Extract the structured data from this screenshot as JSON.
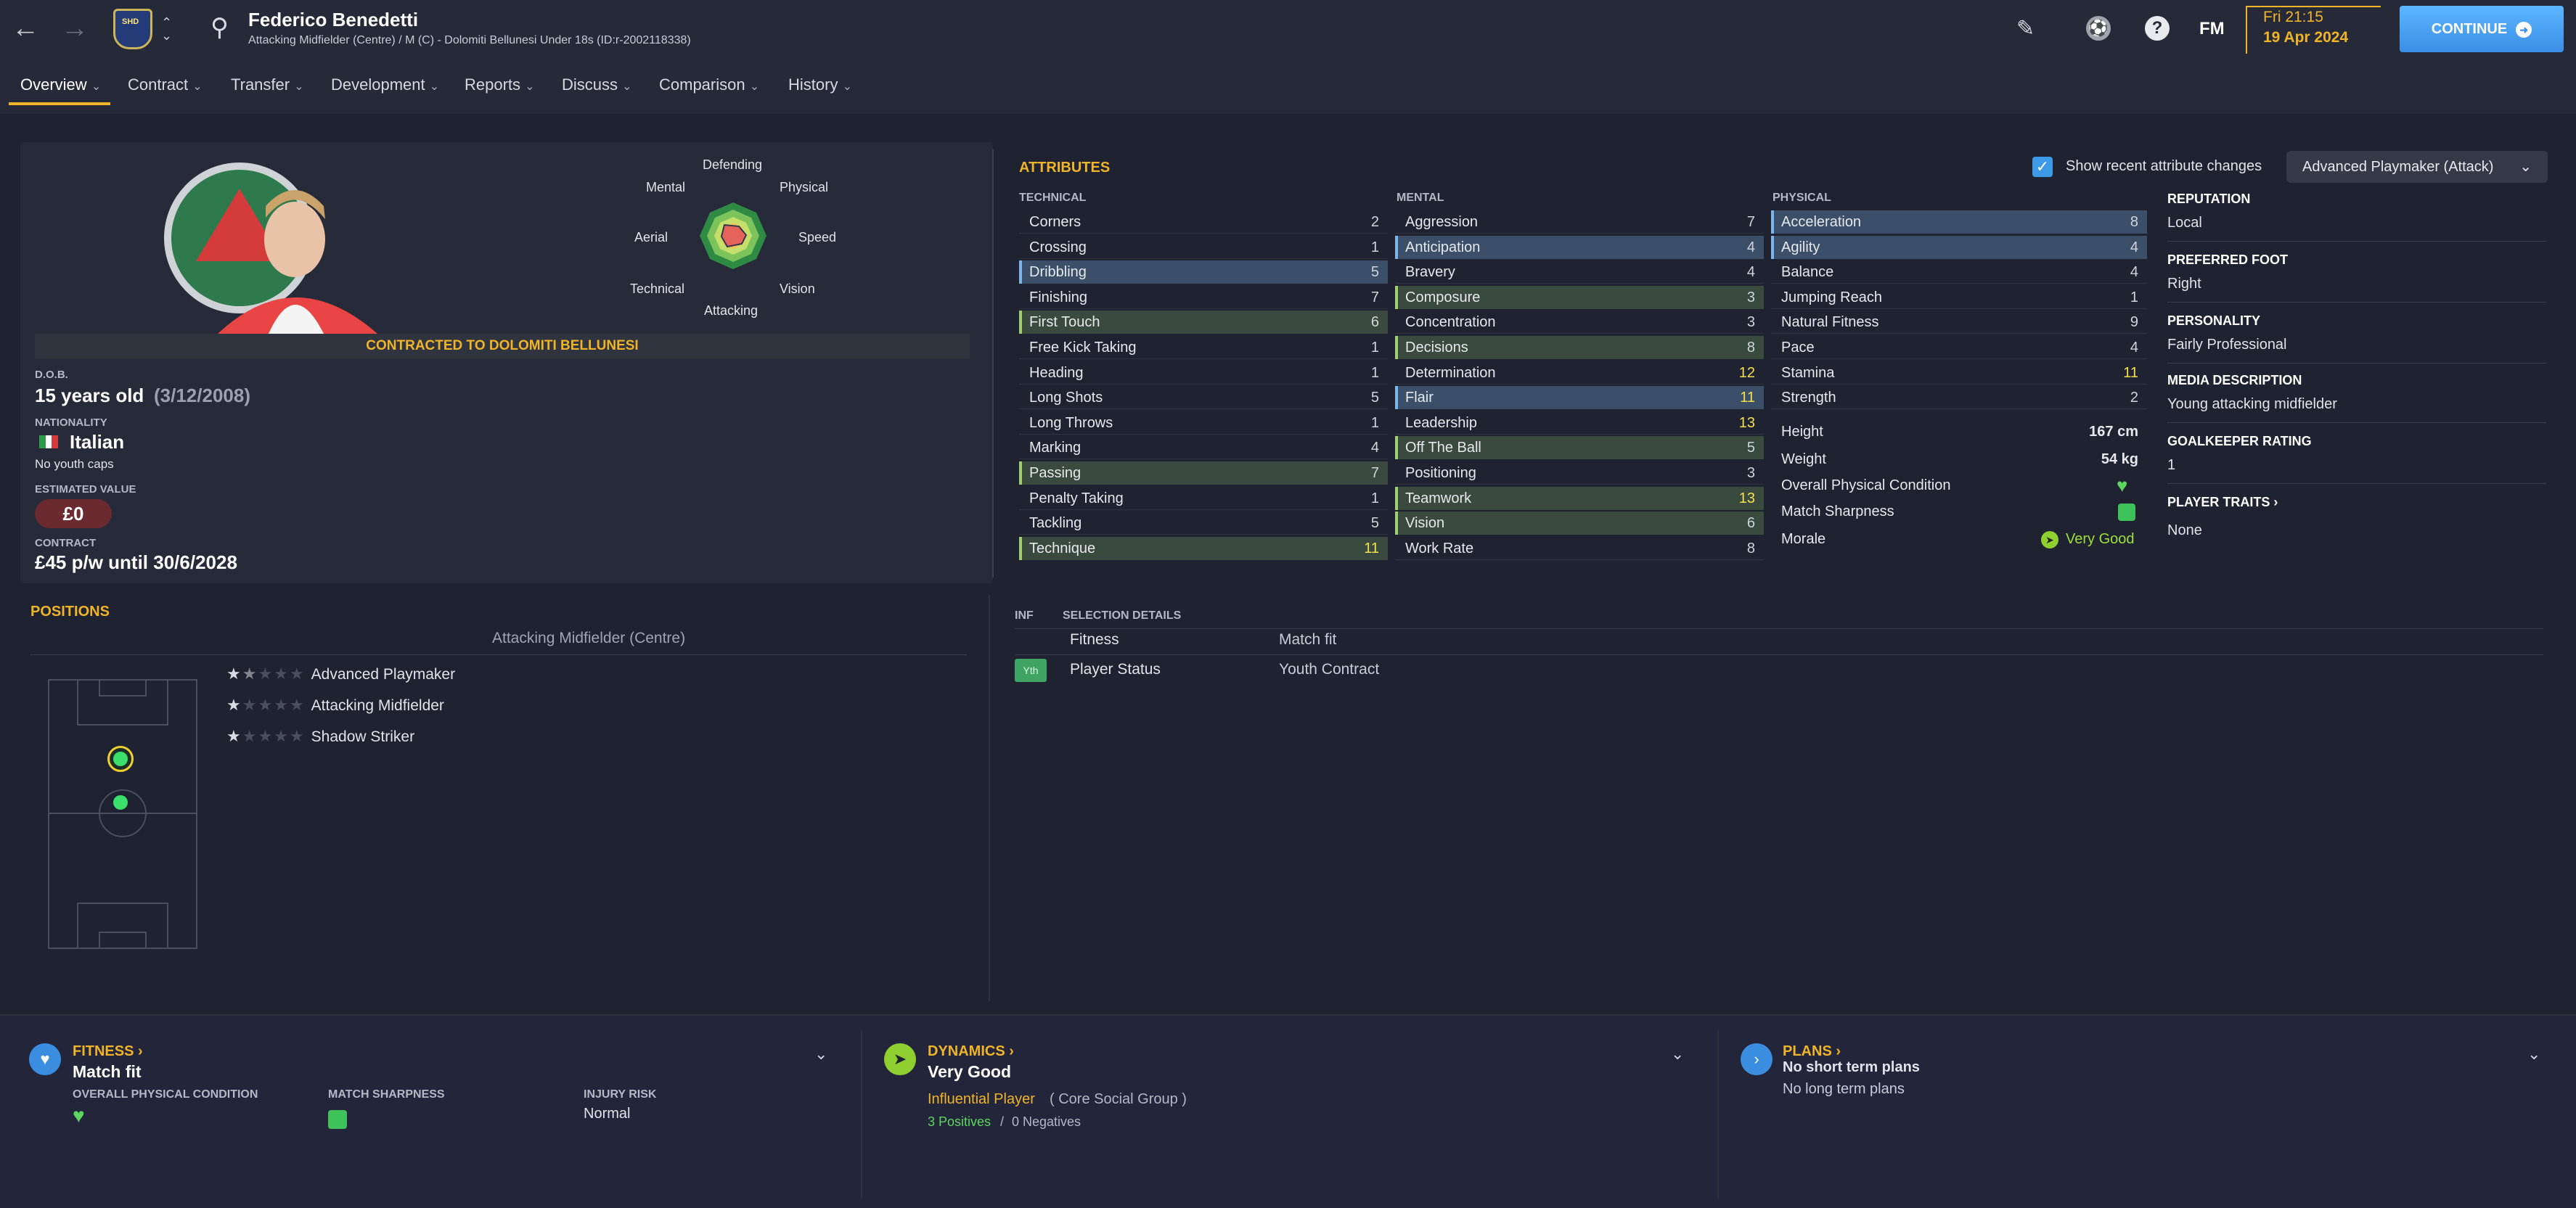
{
  "header": {
    "player_name": "Federico Benedetti",
    "player_sub": "Attacking Midfielder (Centre) / M (C) - Dolomiti Bellunesi Under 18s (ID:r-2002118338)",
    "back_icon": "back-arrow-icon",
    "forward_icon": "forward-arrow-icon",
    "search_icon": "search-icon",
    "edit_icon": "pencil-icon",
    "ball_icon": "football-icon",
    "help_label": "?",
    "fm_label": "FM",
    "date_time": "Fri 21:15",
    "date_day": "19 Apr 2024",
    "continue_label": "CONTINUE"
  },
  "tabs": [
    {
      "label": "Overview"
    },
    {
      "label": "Contract"
    },
    {
      "label": "Transfer"
    },
    {
      "label": "Development"
    },
    {
      "label": "Reports"
    },
    {
      "label": "Discuss"
    },
    {
      "label": "Comparison"
    },
    {
      "label": "History"
    }
  ],
  "overview": {
    "contracted": "CONTRACTED TO DOLOMITI BELLUNESI",
    "dob_label": "D.O.B.",
    "dob_age": "15 years old",
    "dob_date": "(3/12/2008)",
    "nationality_label": "NATIONALITY",
    "nationality": "Italian",
    "youth_caps": "No youth caps",
    "value_label": "ESTIMATED VALUE",
    "value": "£0",
    "contract_label": "CONTRACT",
    "contract": "£45 p/w until 30/6/2028",
    "radar": {
      "labels": [
        "Defending",
        "Physical",
        "Speed",
        "Vision",
        "Attacking",
        "Technical",
        "Aerial",
        "Mental"
      ]
    }
  },
  "attributes": {
    "title": "ATTRIBUTES",
    "show_changes_label": "Show recent attribute changes",
    "role_dropdown": "Advanced Playmaker (Attack)",
    "technical_label": "TECHNICAL",
    "mental_label": "MENTAL",
    "physical_label": "PHYSICAL",
    "technical": [
      {
        "name": "Corners",
        "value": "2",
        "style": "plain"
      },
      {
        "name": "Crossing",
        "value": "1",
        "style": "plain"
      },
      {
        "name": "Dribbling",
        "value": "5",
        "style": "blue"
      },
      {
        "name": "Finishing",
        "value": "7",
        "style": "plain"
      },
      {
        "name": "First Touch",
        "value": "6",
        "style": "green"
      },
      {
        "name": "Free Kick Taking",
        "value": "1",
        "style": "plain"
      },
      {
        "name": "Heading",
        "value": "1",
        "style": "plain"
      },
      {
        "name": "Long Shots",
        "value": "5",
        "style": "plain"
      },
      {
        "name": "Long Throws",
        "value": "1",
        "style": "plain"
      },
      {
        "name": "Marking",
        "value": "4",
        "style": "plain"
      },
      {
        "name": "Passing",
        "value": "7",
        "style": "green"
      },
      {
        "name": "Penalty Taking",
        "value": "1",
        "style": "plain"
      },
      {
        "name": "Tackling",
        "value": "5",
        "style": "plain"
      },
      {
        "name": "Technique",
        "value": "11",
        "style": "green"
      }
    ],
    "mental": [
      {
        "name": "Aggression",
        "value": "7",
        "style": "plain"
      },
      {
        "name": "Anticipation",
        "value": "4",
        "style": "blue"
      },
      {
        "name": "Bravery",
        "value": "4",
        "style": "plain"
      },
      {
        "name": "Composure",
        "value": "3",
        "style": "green"
      },
      {
        "name": "Concentration",
        "value": "3",
        "style": "plain"
      },
      {
        "name": "Decisions",
        "value": "8",
        "style": "green"
      },
      {
        "name": "Determination",
        "value": "12",
        "style": "plain"
      },
      {
        "name": "Flair",
        "value": "11",
        "style": "blue"
      },
      {
        "name": "Leadership",
        "value": "13",
        "style": "plain"
      },
      {
        "name": "Off The Ball",
        "value": "5",
        "style": "green"
      },
      {
        "name": "Positioning",
        "value": "3",
        "style": "plain"
      },
      {
        "name": "Teamwork",
        "value": "13",
        "style": "green"
      },
      {
        "name": "Vision",
        "value": "6",
        "style": "green"
      },
      {
        "name": "Work Rate",
        "value": "8",
        "style": "plain"
      }
    ],
    "physical": [
      {
        "name": "Acceleration",
        "value": "8",
        "style": "blue"
      },
      {
        "name": "Agility",
        "value": "4",
        "style": "blue"
      },
      {
        "name": "Balance",
        "value": "4",
        "style": "plain"
      },
      {
        "name": "Jumping Reach",
        "value": "1",
        "style": "plain"
      },
      {
        "name": "Natural Fitness",
        "value": "9",
        "style": "plain"
      },
      {
        "name": "Pace",
        "value": "4",
        "style": "plain"
      },
      {
        "name": "Stamina",
        "value": "11",
        "style": "plain"
      },
      {
        "name": "Strength",
        "value": "2",
        "style": "plain"
      }
    ],
    "height_label": "Height",
    "height": "167 cm",
    "weight_label": "Weight",
    "weight": "54 kg",
    "opc_label": "Overall Physical Condition",
    "sharpness_label": "Match Sharpness",
    "morale_label": "Morale",
    "morale": "Very Good"
  },
  "profile": {
    "reputation_label": "REPUTATION",
    "reputation": "Local",
    "foot_label": "PREFERRED FOOT",
    "foot": "Right",
    "personality_label": "PERSONALITY",
    "personality": "Fairly Professional",
    "media_label": "MEDIA DESCRIPTION",
    "media": "Young attacking midfielder",
    "gk_label": "GOALKEEPER RATING",
    "gk": "1",
    "traits_label": "PLAYER TRAITS",
    "traits": "None"
  },
  "positions": {
    "title": "POSITIONS",
    "subtitle": "Attacking Midfielder (Centre)",
    "roles": [
      {
        "name": "Advanced Playmaker",
        "stars": 1.5
      },
      {
        "name": "Attacking Midfielder",
        "stars": 1
      },
      {
        "name": "Shadow Striker",
        "stars": 1
      }
    ]
  },
  "selection": {
    "inf_label": "INF",
    "title": "SELECTION DETAILS",
    "fitness_label": "Fitness",
    "fitness": "Match fit",
    "status_badge": "Yth",
    "status_label": "Player Status",
    "status": "Youth Contract"
  },
  "bottom": {
    "fitness_title": "FITNESS",
    "fitness_value": "Match fit",
    "opc_label": "OVERALL PHYSICAL CONDITION",
    "sharpness_label": "MATCH SHARPNESS",
    "injury_label": "INJURY RISK",
    "injury_value": "Normal",
    "dynamics_title": "DYNAMICS",
    "dynamics_value": "Very Good",
    "dynamics_role": "Influential Player",
    "dynamics_group": "( Core Social Group )",
    "positives": "3 Positives",
    "negatives": "0 Negatives",
    "plans_title": "PLANS",
    "plans_short": "No short term plans",
    "plans_long": "No long term plans"
  },
  "colors": {
    "accent": "#f0b429",
    "continue": "#4aa3f5",
    "green_highlight": "#3a4a3e",
    "blue_highlight": "#3b5068"
  }
}
